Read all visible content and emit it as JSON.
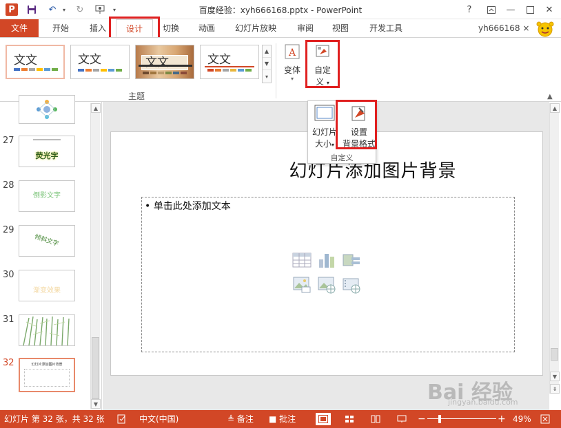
{
  "titlebar": {
    "title": "百度经验：xyh666168.pptx - PowerPoint",
    "app_logo": "P",
    "help": "?",
    "minimize": "—",
    "close": "✕"
  },
  "tabs": [
    {
      "label": "文件"
    },
    {
      "label": "开始"
    },
    {
      "label": "插入"
    },
    {
      "label": "设计"
    },
    {
      "label": "切换"
    },
    {
      "label": "动画"
    },
    {
      "label": "幻灯片放映"
    },
    {
      "label": "审阅"
    },
    {
      "label": "视图"
    },
    {
      "label": "开发工具"
    }
  ],
  "user": {
    "name": "yh666168 ×"
  },
  "ribbon": {
    "themes": [
      {
        "label": "文文"
      },
      {
        "label": "文文"
      },
      {
        "label": "文文"
      },
      {
        "label": "文文"
      }
    ],
    "theme_group_label": "主题",
    "variants_label": "变体",
    "customize_label": "自定",
    "customize_label2": "义",
    "dropdown_arrow": "▾"
  },
  "popup": {
    "slide_size_label": "幻灯片",
    "slide_size_label2": "大小",
    "format_bg_label": "设置",
    "format_bg_label2": "背景格式",
    "group_label": "自定义"
  },
  "slides": [
    {
      "number": "27",
      "text": "荧光字"
    },
    {
      "number": "28",
      "text": "倒影文字"
    },
    {
      "number": "29",
      "text": "倾斜文字"
    },
    {
      "number": "30",
      "text": "渐变效果"
    },
    {
      "number": "31",
      "text": ""
    },
    {
      "number": "32",
      "text": "幻灯片添加图片背景"
    }
  ],
  "current_slide": {
    "title": "幻灯片添加图片背景",
    "bullet": "• 单击此处添加文本"
  },
  "statusbar": {
    "slide_info": "幻灯片 第 32 张，共 32 张",
    "language": "中文(中国)",
    "notes": "备注",
    "comments": "批注",
    "zoom": "49%",
    "zoom_minus": "−",
    "zoom_plus": "+"
  },
  "watermark": {
    "text": "Bai 经验",
    "url": "jingyan.baidu.com"
  },
  "colors": {
    "accent": "#d24726",
    "highlight": "#e02020"
  }
}
